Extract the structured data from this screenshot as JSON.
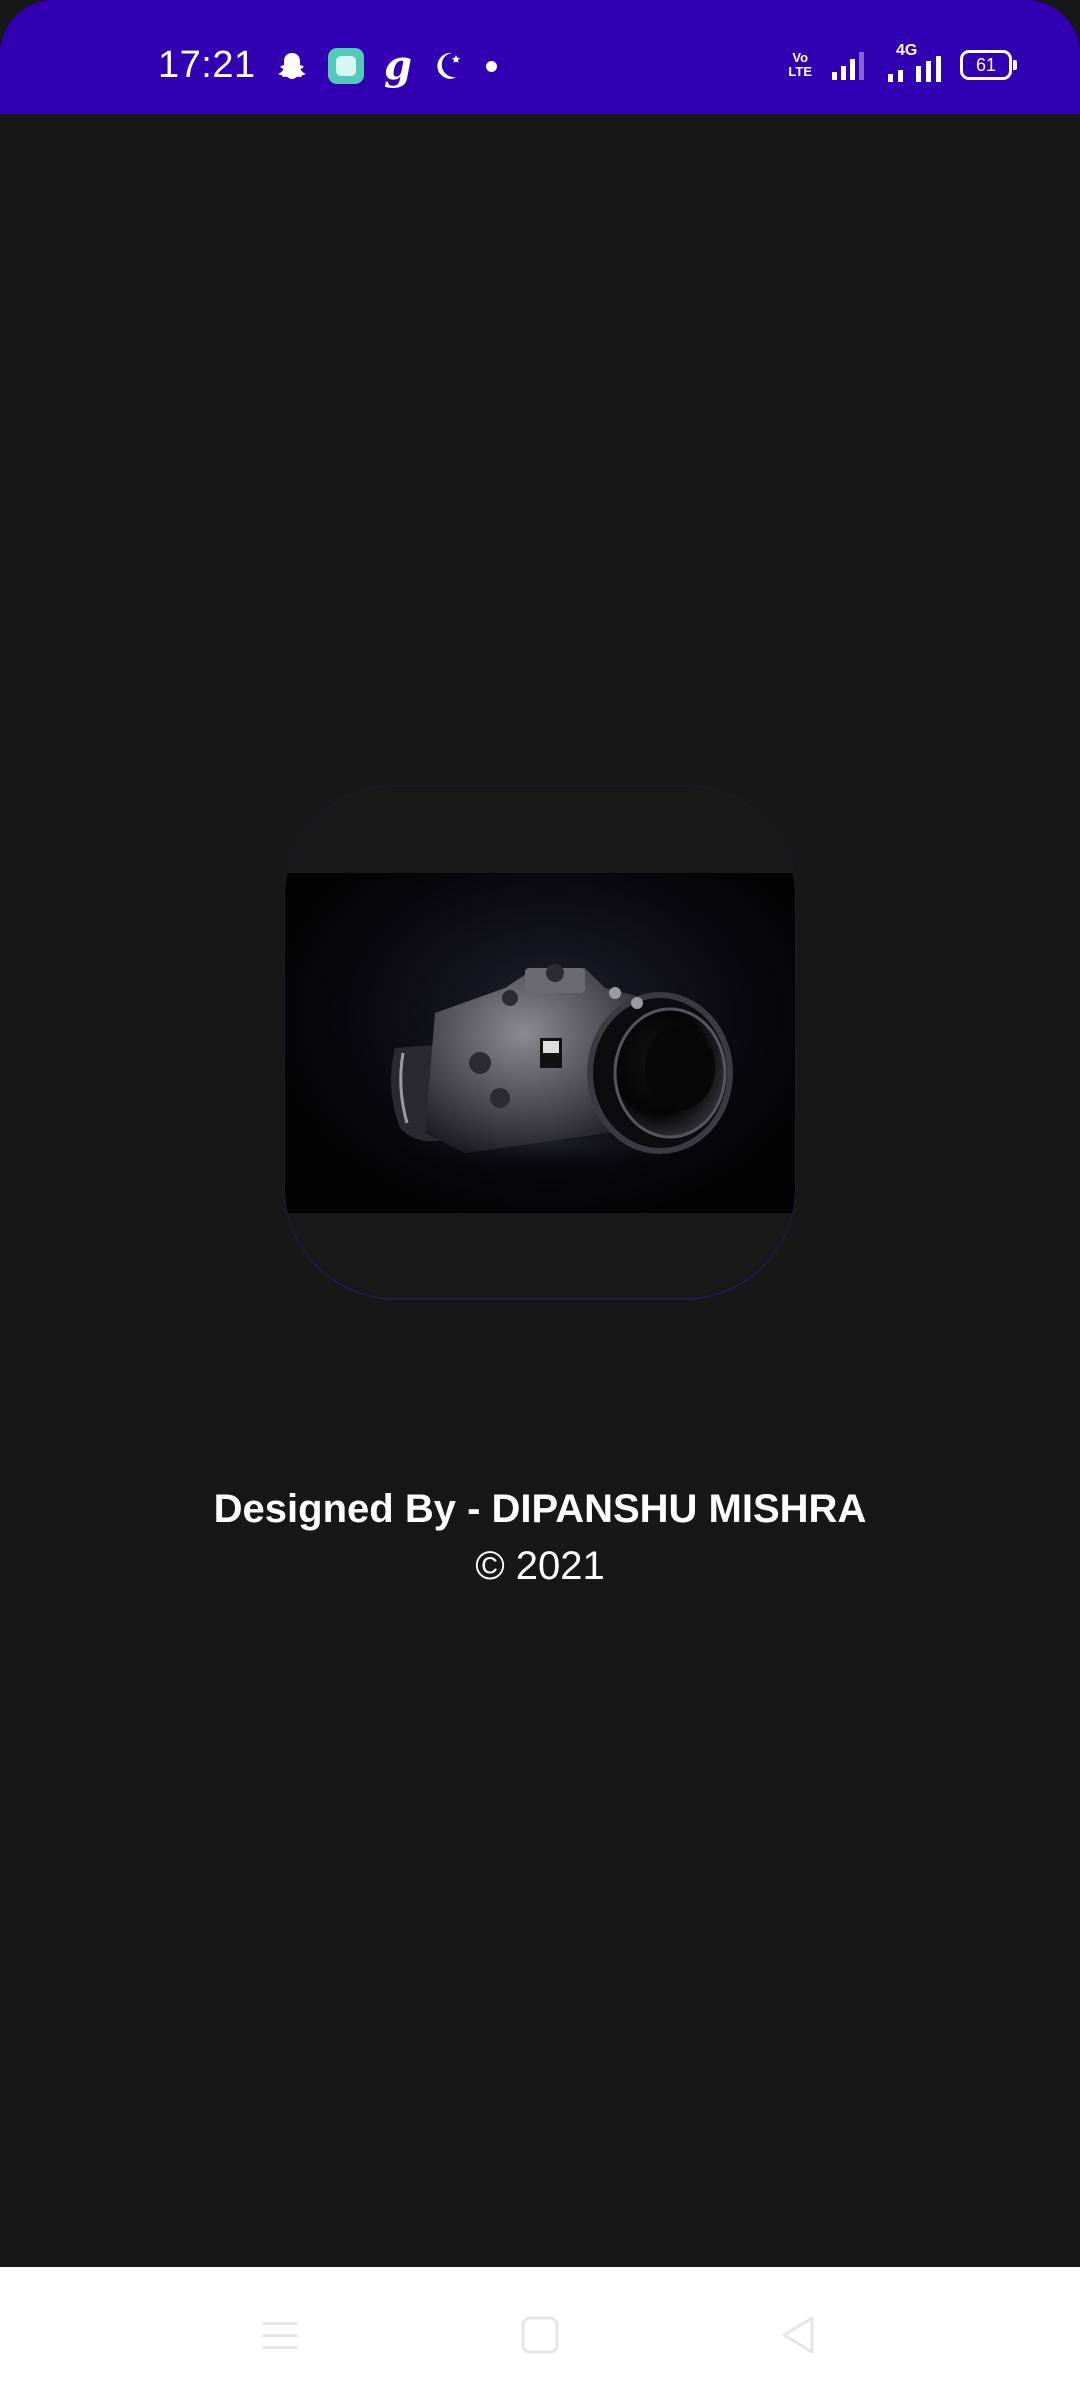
{
  "status_bar": {
    "time": "17:21",
    "background_color": "#3200b3",
    "left_icons": [
      "snapchat-icon",
      "app-notification-icon",
      "g-app-icon",
      "moon-icon",
      "dot-icon"
    ],
    "network_label_top": "Vo",
    "network_label_bottom": "LTE",
    "network_type": "4G",
    "battery_level": "61"
  },
  "splash": {
    "logo_description_icon": "camera-image",
    "designer_text": "Designed By - DIPANSHU MISHRA",
    "copyright_text": "© 2021"
  },
  "navigation_bar": {
    "buttons": [
      "menu-icon",
      "home-icon",
      "back-icon"
    ]
  }
}
